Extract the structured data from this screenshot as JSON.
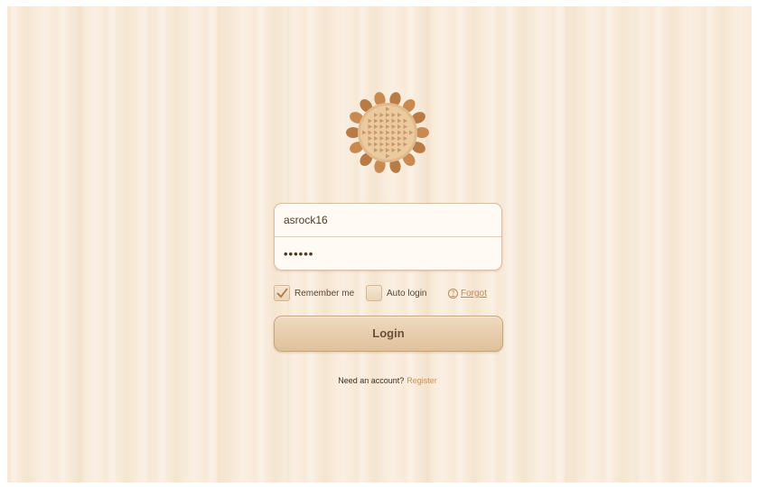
{
  "login": {
    "username_value": "asrock16",
    "password_value": "••••••",
    "remember_me_label": "Remember me",
    "remember_me_checked": true,
    "auto_login_label": "Auto login",
    "auto_login_checked": false,
    "forgot_label": "Forgot",
    "forgot_icon_glyph": "?",
    "login_button_label": "Login",
    "need_account_text": "Need an account?",
    "register_label": "Register"
  },
  "colors": {
    "background": "#f8ead9",
    "accent": "#cf8f52",
    "button": "#e6cba8",
    "logo_petal": "#c98a52",
    "logo_center": "#e8c59b"
  },
  "icons": {
    "logo": "sunflower-logo-icon",
    "checkbox_check": "check-icon",
    "forgot": "question-circle-icon"
  }
}
